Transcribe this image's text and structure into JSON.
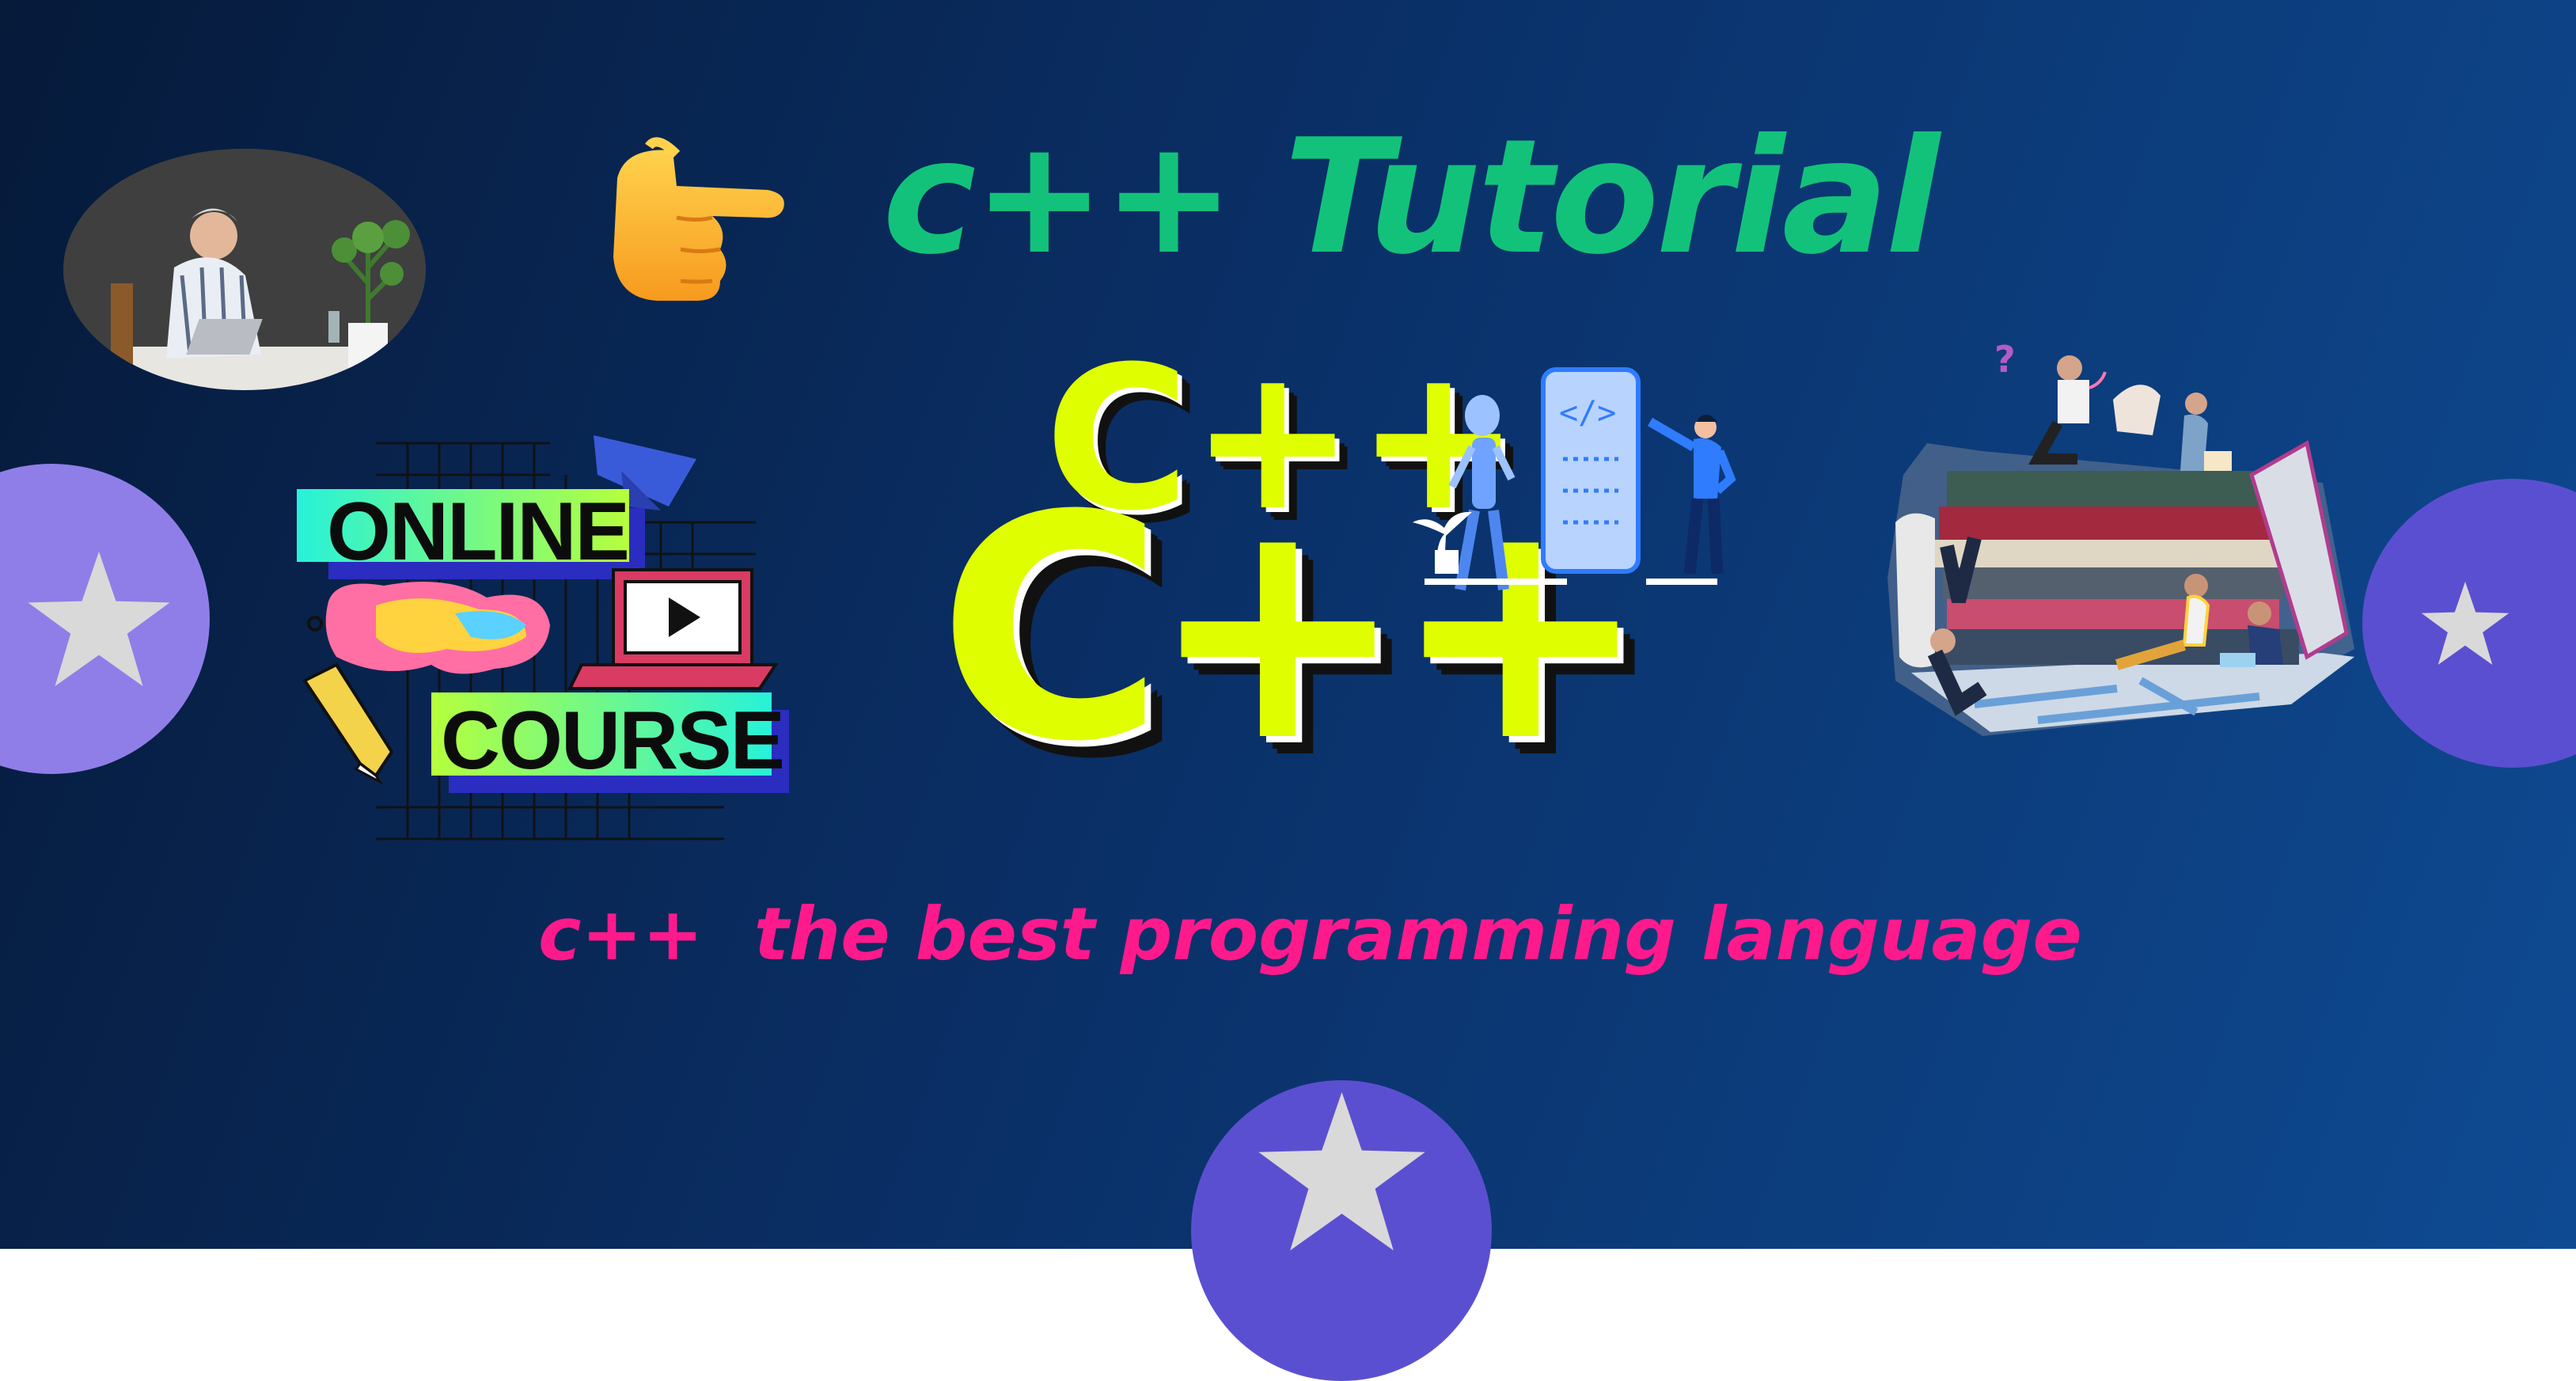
{
  "headline": {
    "title": "c++ Tutorial",
    "tagline": "c++  the best programming language"
  },
  "badge": {
    "line1": "ONLINE",
    "line2": "COURSE"
  },
  "logo": {
    "small": "C++",
    "big": "C++"
  },
  "phone": {
    "code": "</>"
  },
  "colors": {
    "title": "#12c27a",
    "tagline": "#ff1a8c",
    "lime": "#dfff00",
    "star_circle_light": "#8f7ee8",
    "star_circle_dark": "#5b4fd1",
    "star": "#d9d9d9"
  },
  "icons": [
    "pointing-hand-icon",
    "star-icon",
    "play-icon",
    "graduation-cap-icon",
    "pencil-icon",
    "robot-icon"
  ]
}
